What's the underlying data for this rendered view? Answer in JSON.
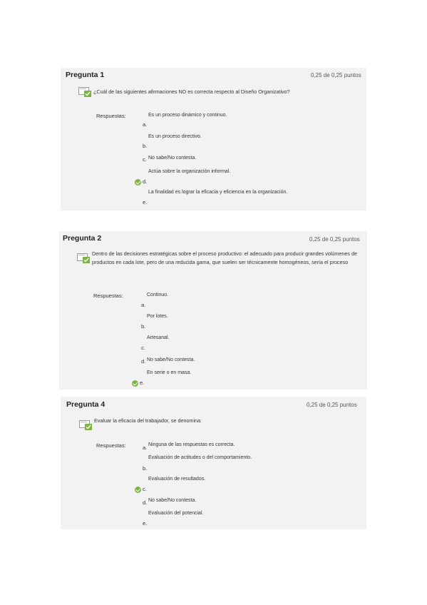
{
  "questions": [
    {
      "title": "Pregunta 1",
      "score": "0,25 de 0,25 puntos",
      "text": "¿Cuál de las siguientes afirmaciones NO es correcta respecto al Diseño Organizativo?",
      "responses_label": "Respuestas:",
      "answers": [
        {
          "letter": "a.",
          "text": "Es un proceso dinámico y continuo.",
          "correct": false
        },
        {
          "letter": "b.",
          "text": "Es un proceso directivo.",
          "correct": false
        },
        {
          "letter": "c.",
          "text": "No sabe/No contesta.",
          "correct": false
        },
        {
          "letter": "d.",
          "text": "Actúa sobre la organización informal.",
          "correct": true
        },
        {
          "letter": "e.",
          "text": "La finalidad es lograr la eficacia y eficiencia en la organización.",
          "correct": false
        }
      ]
    },
    {
      "title": "Pregunta 2",
      "score": "0,25 de 0,25 puntos",
      "text": "Dentro de las decisiones estratégicas sobre el proceso productivo: el adecuado para producir grandes volúmenes de productos en cada lote, pero de una reducida gama, que suelen ser técnicamente homogéneos, sería el proceso",
      "responses_label": "Respuestas:",
      "answers": [
        {
          "letter": "a.",
          "text": "Continuo.",
          "correct": false
        },
        {
          "letter": "b.",
          "text": "Por lotes.",
          "correct": false
        },
        {
          "letter": "c.",
          "text": "Artesanal.",
          "correct": false
        },
        {
          "letter": "d.",
          "text": "No sabe/No contesta.",
          "correct": false
        },
        {
          "letter": "e.",
          "text": "En serie o en masa.",
          "correct": true
        }
      ]
    },
    {
      "title": "Pregunta 4",
      "score": "0,25 de 0,25 puntos",
      "text": "Evaluar la eficacia del trabajador, se denomina:",
      "responses_label": "Respuestas:",
      "answers": [
        {
          "letter": "a.",
          "text": "Ninguna de las respuestas es correcta.",
          "correct": false
        },
        {
          "letter": "b.",
          "text": "Evaluación de actitudes o del comportamiento.",
          "correct": false
        },
        {
          "letter": "c.",
          "text": "Evaluación de resultados.",
          "correct": true
        },
        {
          "letter": "d.",
          "text": "No sabe/No contesta.",
          "correct": false
        },
        {
          "letter": "e.",
          "text": "Evaluación del potencial.",
          "correct": false
        }
      ]
    }
  ],
  "colors": {
    "card_bg": "#f2f2f2",
    "check": "#7cb342"
  },
  "icons": {
    "question_status": "checked-document-icon",
    "correct_answer": "check-circle-icon"
  }
}
